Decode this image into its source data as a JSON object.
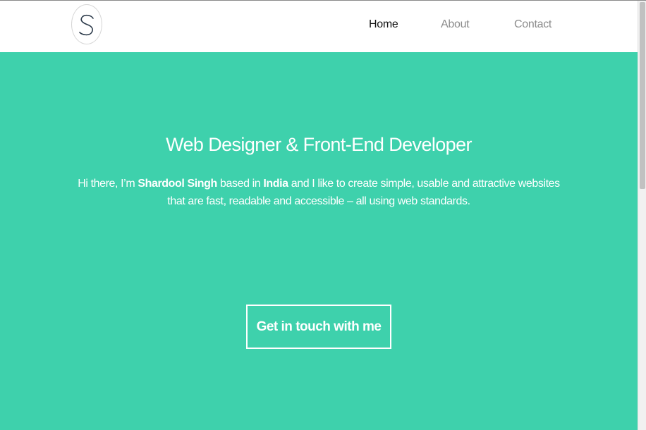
{
  "navbar": {
    "logo_letter": "S",
    "links": [
      {
        "label": "Home",
        "active": true
      },
      {
        "label": "About",
        "active": false
      },
      {
        "label": "Contact",
        "active": false
      }
    ]
  },
  "hero": {
    "title": "Web Designer & Front-End Developer",
    "intro_part1": "Hi there, I’m ",
    "name": "Shardool Singh",
    "intro_part2": " based in ",
    "location": "India",
    "intro_part3": " and I like to create simple, usable and attractive websites that are fast, readable and accessible – all using web standards.",
    "cta_label": "Get in touch with me"
  },
  "colors": {
    "hero_background": "#3ed1ac",
    "nav_active": "#111111",
    "nav_inactive": "#8c8c8c",
    "text_on_hero": "#ffffff"
  }
}
